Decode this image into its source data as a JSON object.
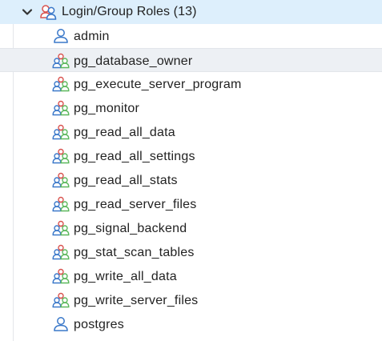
{
  "header": {
    "label": "Login/Group Roles (13)",
    "expanded": true,
    "icon": "login-group-roles-icon"
  },
  "colors": {
    "header_bg": "#ddeffc",
    "selected_bg": "#edf0f4",
    "user_icon": "#3a78c9",
    "group_red": "#d9534f",
    "group_blue": "#3a78c9",
    "group_green": "#5cb85c"
  },
  "selected_index": 1,
  "roles": [
    {
      "label": "admin",
      "icon": "login-role-icon"
    },
    {
      "label": "pg_database_owner",
      "icon": "group-role-icon"
    },
    {
      "label": "pg_execute_server_program",
      "icon": "group-role-icon"
    },
    {
      "label": "pg_monitor",
      "icon": "group-role-icon"
    },
    {
      "label": "pg_read_all_data",
      "icon": "group-role-icon"
    },
    {
      "label": "pg_read_all_settings",
      "icon": "group-role-icon"
    },
    {
      "label": "pg_read_all_stats",
      "icon": "group-role-icon"
    },
    {
      "label": "pg_read_server_files",
      "icon": "group-role-icon"
    },
    {
      "label": "pg_signal_backend",
      "icon": "group-role-icon"
    },
    {
      "label": "pg_stat_scan_tables",
      "icon": "group-role-icon"
    },
    {
      "label": "pg_write_all_data",
      "icon": "group-role-icon"
    },
    {
      "label": "pg_write_server_files",
      "icon": "group-role-icon"
    },
    {
      "label": "postgres",
      "icon": "login-role-icon"
    }
  ]
}
